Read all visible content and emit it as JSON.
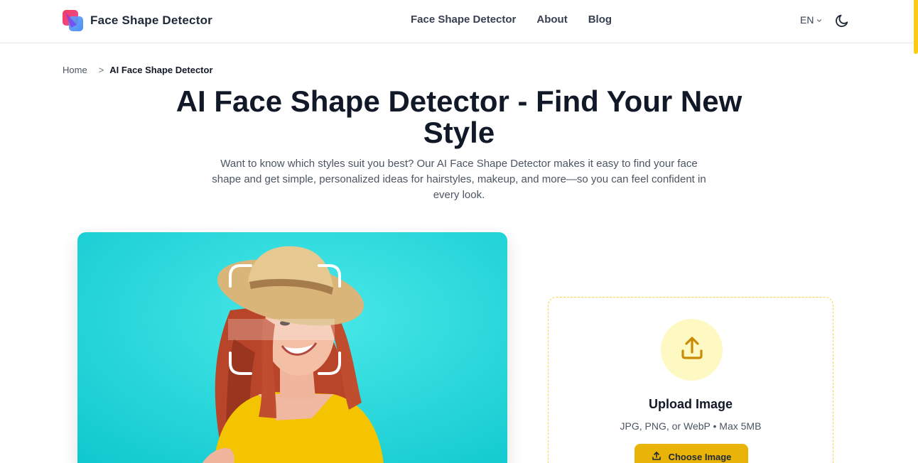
{
  "header": {
    "brand_name": "Face Shape Detector",
    "nav": [
      {
        "label": "Face Shape Detector"
      },
      {
        "label": "About"
      },
      {
        "label": "Blog"
      }
    ],
    "language": "EN",
    "icons": {
      "logo": "brand-logo-icon",
      "lang": "chevron-down-icon",
      "theme": "moon-icon"
    }
  },
  "breadcrumb": {
    "home": "Home",
    "separator": ">",
    "current": "AI Face Shape Detector"
  },
  "hero": {
    "title": "AI Face Shape Detector - Find Your New Style",
    "description": "Want to know which styles suit you best? Our AI Face Shape Detector makes it easy to find your face shape and get simple, personalized ideas for hairstyles, makeup, and more—so you can feel confident in every look."
  },
  "upload": {
    "title": "Upload Image",
    "hint": "JPG, PNG, or WebP • Max 5MB",
    "button_label": "Choose Image",
    "icon": "upload-icon"
  },
  "colors": {
    "accent": "#eab308",
    "accent_light": "#fef9c3",
    "photo_bg": "#1fd6d6",
    "text_dark": "#111827"
  }
}
